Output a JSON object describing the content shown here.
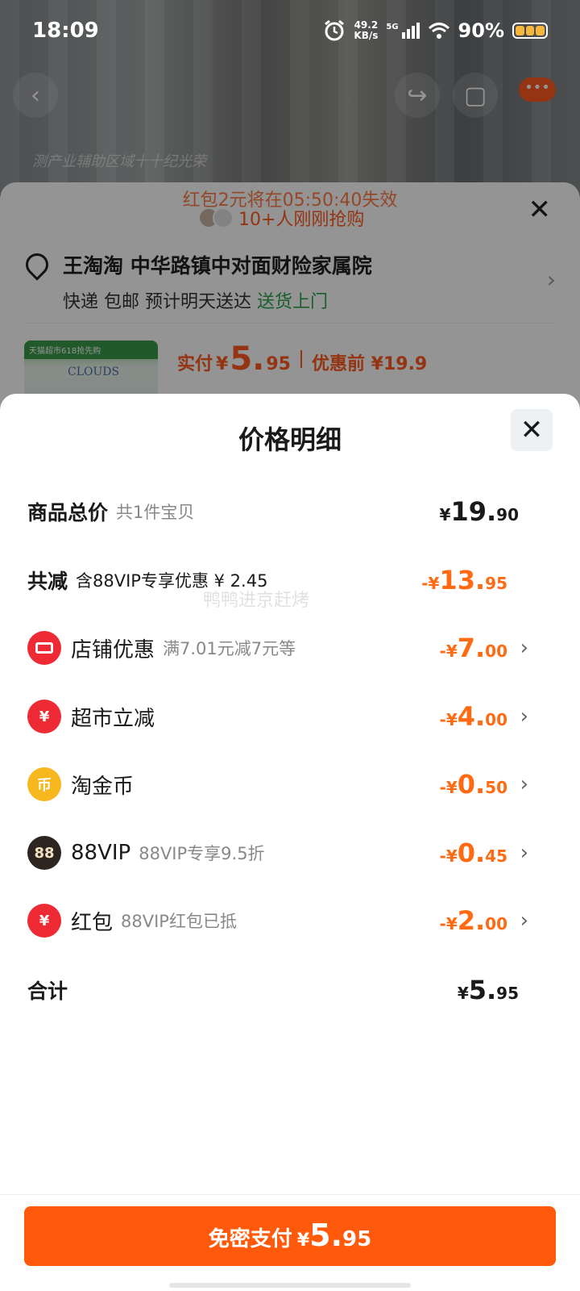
{
  "status_bar": {
    "time": "18:09",
    "net_speed_value": "49.2",
    "net_speed_unit": "KB/s",
    "network": "5G",
    "battery": "90%"
  },
  "background": {
    "watermark": "测产业辅助区域十十纪光荣",
    "coupon_timer": "红包2元将在05:50:40失效",
    "rush_text": "10+人刚刚抢购",
    "address_name": "王淘淘 中华路镇中对面财险家属院",
    "delivery_info": "快递 包邮 预计明天送达",
    "delivery_green": "送货上门",
    "product_banner": "天猫超市618抢先购",
    "product_brand": "CLOUDS",
    "price_label": "实付",
    "price_currency": "¥",
    "price_int": "5.",
    "price_dec": "95",
    "original_price": "优惠前 ¥19.9"
  },
  "modal": {
    "title": "价格明细",
    "watermark": "鸭鸭进京赶烤",
    "rows": [
      {
        "label": "商品总价",
        "sub": "共1件宝贝",
        "currency": "¥",
        "int": "19.",
        "dec": "90"
      },
      {
        "label": "共减",
        "sub": "含88VIP专享优惠 ¥ 2.45",
        "currency": "-¥",
        "int": "13.",
        "dec": "95"
      },
      {
        "label": "店铺优惠",
        "sub": "满7.01元减7元等",
        "currency": "-¥",
        "int": "7.",
        "dec": "00",
        "icon": "shop-icon"
      },
      {
        "label": "超市立减",
        "sub": "",
        "currency": "-¥",
        "int": "4.",
        "dec": "00",
        "icon": "discount-yuan-icon"
      },
      {
        "label": "淘金币",
        "sub": "",
        "currency": "-¥",
        "int": "0.",
        "dec": "50",
        "icon": "coin-icon"
      },
      {
        "label": "88VIP",
        "sub": "88VIP专享9.5折",
        "currency": "-¥",
        "int": "0.",
        "dec": "45",
        "icon": "vip88-icon"
      },
      {
        "label": "红包",
        "sub": "88VIP红包已抵",
        "currency": "-¥",
        "int": "2.",
        "dec": "00",
        "icon": "red-envelope-icon"
      },
      {
        "label": "合计",
        "sub": "",
        "currency": "¥",
        "int": "5.",
        "dec": "95"
      }
    ],
    "icon_glyphs": {
      "coin": "币",
      "vip88": "88",
      "envelope": "¥",
      "discount": "¥"
    }
  },
  "pay_button": {
    "label": "免密支付",
    "currency": "¥",
    "int": "5.",
    "dec": "95"
  },
  "colors": {
    "accent": "#ff5a0b",
    "discount": "#ff6a13",
    "green": "#2ba24c"
  }
}
